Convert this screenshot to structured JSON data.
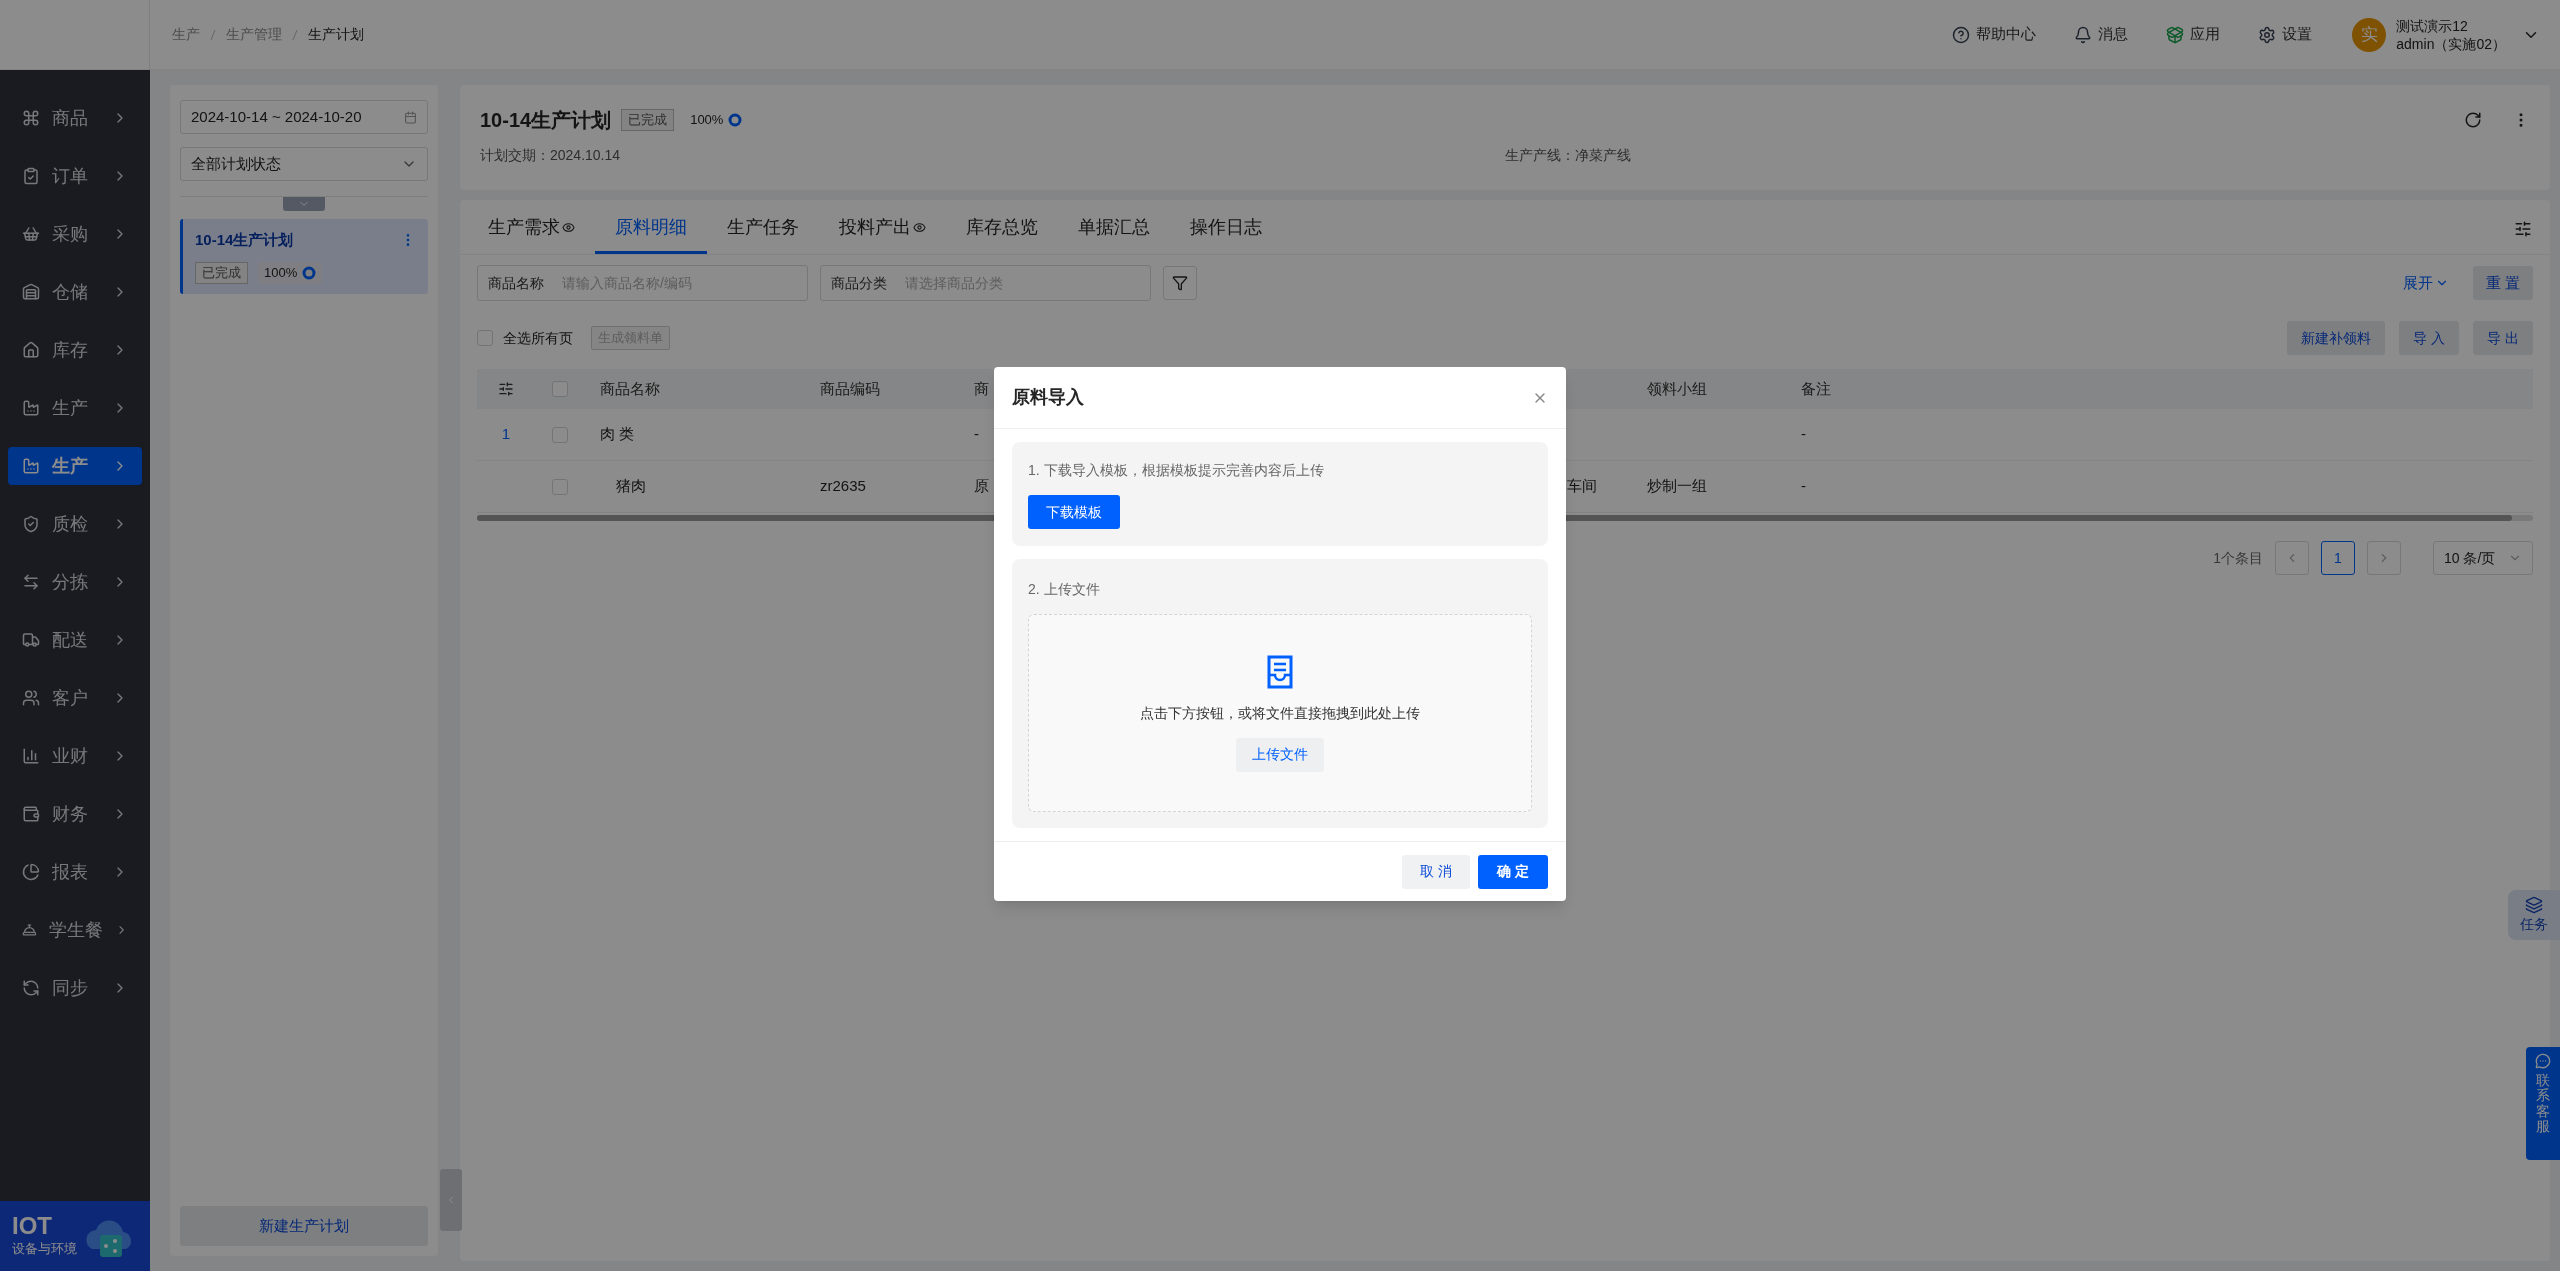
{
  "breadcrumb": [
    {
      "label": "生产",
      "current": false
    },
    {
      "label": "生产管理",
      "current": false
    },
    {
      "label": "生产计划",
      "current": true
    }
  ],
  "header_actions": [
    {
      "label": "帮助中心"
    },
    {
      "label": "消息"
    },
    {
      "label": "应用"
    },
    {
      "label": "设置"
    }
  ],
  "user": {
    "avatar": "实",
    "name": "测试演示12",
    "role": "admin（实施02）"
  },
  "sidebar": {
    "items": [
      {
        "label": "商品",
        "selected": false
      },
      {
        "label": "订单",
        "selected": false
      },
      {
        "label": "采购",
        "selected": false
      },
      {
        "label": "仓储",
        "selected": false
      },
      {
        "label": "库存",
        "selected": false
      },
      {
        "label": "生产",
        "selected": false
      },
      {
        "label": "生产",
        "selected": true
      },
      {
        "label": "质检",
        "selected": false
      },
      {
        "label": "分拣",
        "selected": false
      },
      {
        "label": "配送",
        "selected": false
      },
      {
        "label": "客户",
        "selected": false
      },
      {
        "label": "业财",
        "selected": false
      },
      {
        "label": "财务",
        "selected": false
      },
      {
        "label": "报表",
        "selected": false
      },
      {
        "label": "学生餐",
        "selected": false
      },
      {
        "label": "同步",
        "selected": false
      }
    ],
    "footer": {
      "title": "IOT",
      "subtitle": "设备与环境"
    }
  },
  "plan_panel": {
    "date_range": "2024-10-14 ~ 2024-10-20",
    "status_select": "全部计划状态",
    "plans": [
      {
        "title": "10-14生产计划",
        "status": "已完成",
        "progress": "100%",
        "selected": true
      }
    ],
    "new_button": "新建生产计划"
  },
  "plan_header": {
    "title": "10-14生产计划",
    "status": "已完成",
    "progress": "100%",
    "due_date": "计划交期：2024.10.14",
    "line": "生产产线：净菜产线"
  },
  "tabs": [
    {
      "label": "生产需求",
      "selected": false,
      "kind": "eye"
    },
    {
      "label": "原料明细",
      "selected": true,
      "kind": "plain"
    },
    {
      "label": "生产任务",
      "selected": false,
      "kind": "plain"
    },
    {
      "label": "投料产出",
      "selected": false,
      "kind": "eye"
    },
    {
      "label": "库存总览",
      "selected": false,
      "kind": "plain"
    },
    {
      "label": "单据汇总",
      "selected": false,
      "kind": "plain"
    },
    {
      "label": "操作日志",
      "selected": false,
      "kind": "plain"
    }
  ],
  "filters": [
    {
      "label": "商品名称",
      "placeholder": "请输入商品名称/编码"
    },
    {
      "label": "商品分类",
      "placeholder": "请选择商品分类"
    }
  ],
  "expand_link": "展开",
  "reset_button": "重 置",
  "select_all": {
    "label": "全选所有页",
    "checked": false
  },
  "generate_button": {
    "label": "生成领料单",
    "disabled": true
  },
  "actions": [
    "新建补领料",
    "导 入",
    "导 出"
  ],
  "table": {
    "header_checked": false,
    "columns": {
      "name": "商品名称",
      "code": "商品编码",
      "column_3": "商",
      "group": "领料小组",
      "remark": "备注"
    },
    "rows": [
      {
        "kind": "group",
        "index": "1",
        "checked": false,
        "name": "肉 类",
        "column_3": "-",
        "remark": "-"
      },
      {
        "kind": "item",
        "checked": false,
        "name": "猪肉",
        "code": "zr2635",
        "column_3": "原",
        "column_5": "车间",
        "group": "炒制一组",
        "remark": "-"
      }
    ]
  },
  "pagination": {
    "total": "1个条目",
    "page": "1",
    "page_size": "10 条/页"
  },
  "modal": {
    "title": "原料导入",
    "step1": "1. 下载导入模板，根据模板提示完善内容后上传",
    "download_button": "下载模板",
    "step2": "2. 上传文件",
    "hint": "点击下方按钮，或将文件直接拖拽到此处上传",
    "upload_button": "上传文件",
    "cancel": "取 消",
    "confirm": "确 定"
  },
  "float": {
    "task": "任务",
    "service": "联系客服"
  }
}
